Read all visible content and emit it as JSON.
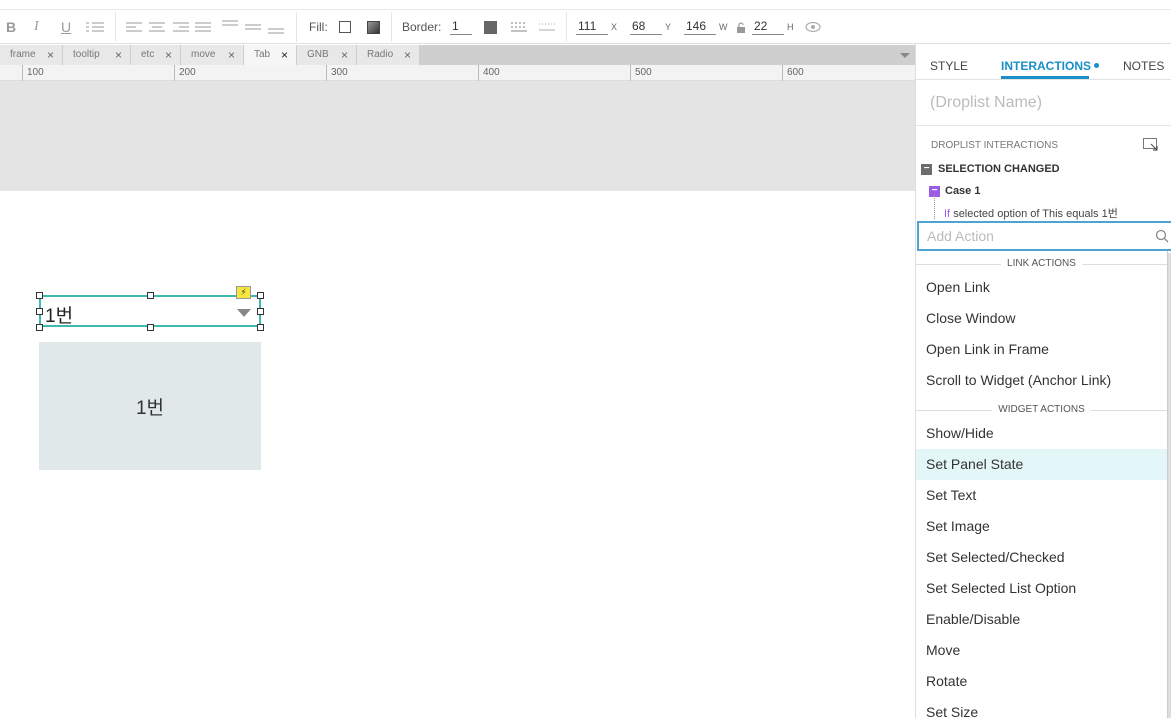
{
  "toolbar": {
    "fill_label": "Fill:",
    "border_label": "Border:",
    "border_value": "1",
    "x_value": "111",
    "x_label": "X",
    "y_value": "68",
    "y_label": "Y",
    "w_value": "146",
    "w_label": "W",
    "h_value": "22",
    "h_label": "H"
  },
  "tabs": [
    {
      "label": "frame"
    },
    {
      "label": "tooltip"
    },
    {
      "label": "etc"
    },
    {
      "label": "move"
    },
    {
      "label": "Tab"
    },
    {
      "label": "GNB"
    },
    {
      "label": "Radio"
    }
  ],
  "ruler": {
    "labels": [
      "100",
      "200",
      "300",
      "400",
      "500",
      "600"
    ]
  },
  "canvas": {
    "droplist_value": "1번",
    "panel_text": "1번"
  },
  "right_panel": {
    "tabs": {
      "style": "STYLE",
      "interactions": "INTERACTIONS",
      "notes": "NOTES"
    },
    "droplist_name_placeholder": "(Droplist Name)",
    "section_title": "DROPLIST INTERACTIONS",
    "event": "SELECTION CHANGED",
    "case": "Case 1",
    "condition_if": "If",
    "condition_text": "selected option of This equals 1번",
    "add_action_placeholder": "Add Action",
    "groups": [
      {
        "title": "LINK ACTIONS",
        "items": [
          "Open Link",
          "Close Window",
          "Open Link in Frame",
          "Scroll to Widget (Anchor Link)"
        ]
      },
      {
        "title": "WIDGET ACTIONS",
        "items": [
          "Show/Hide",
          "Set Panel State",
          "Set Text",
          "Set Image",
          "Set Selected/Checked",
          "Set Selected List Option",
          "Enable/Disable",
          "Move",
          "Rotate",
          "Set Size"
        ]
      }
    ],
    "highlighted_item": "Set Panel State"
  }
}
